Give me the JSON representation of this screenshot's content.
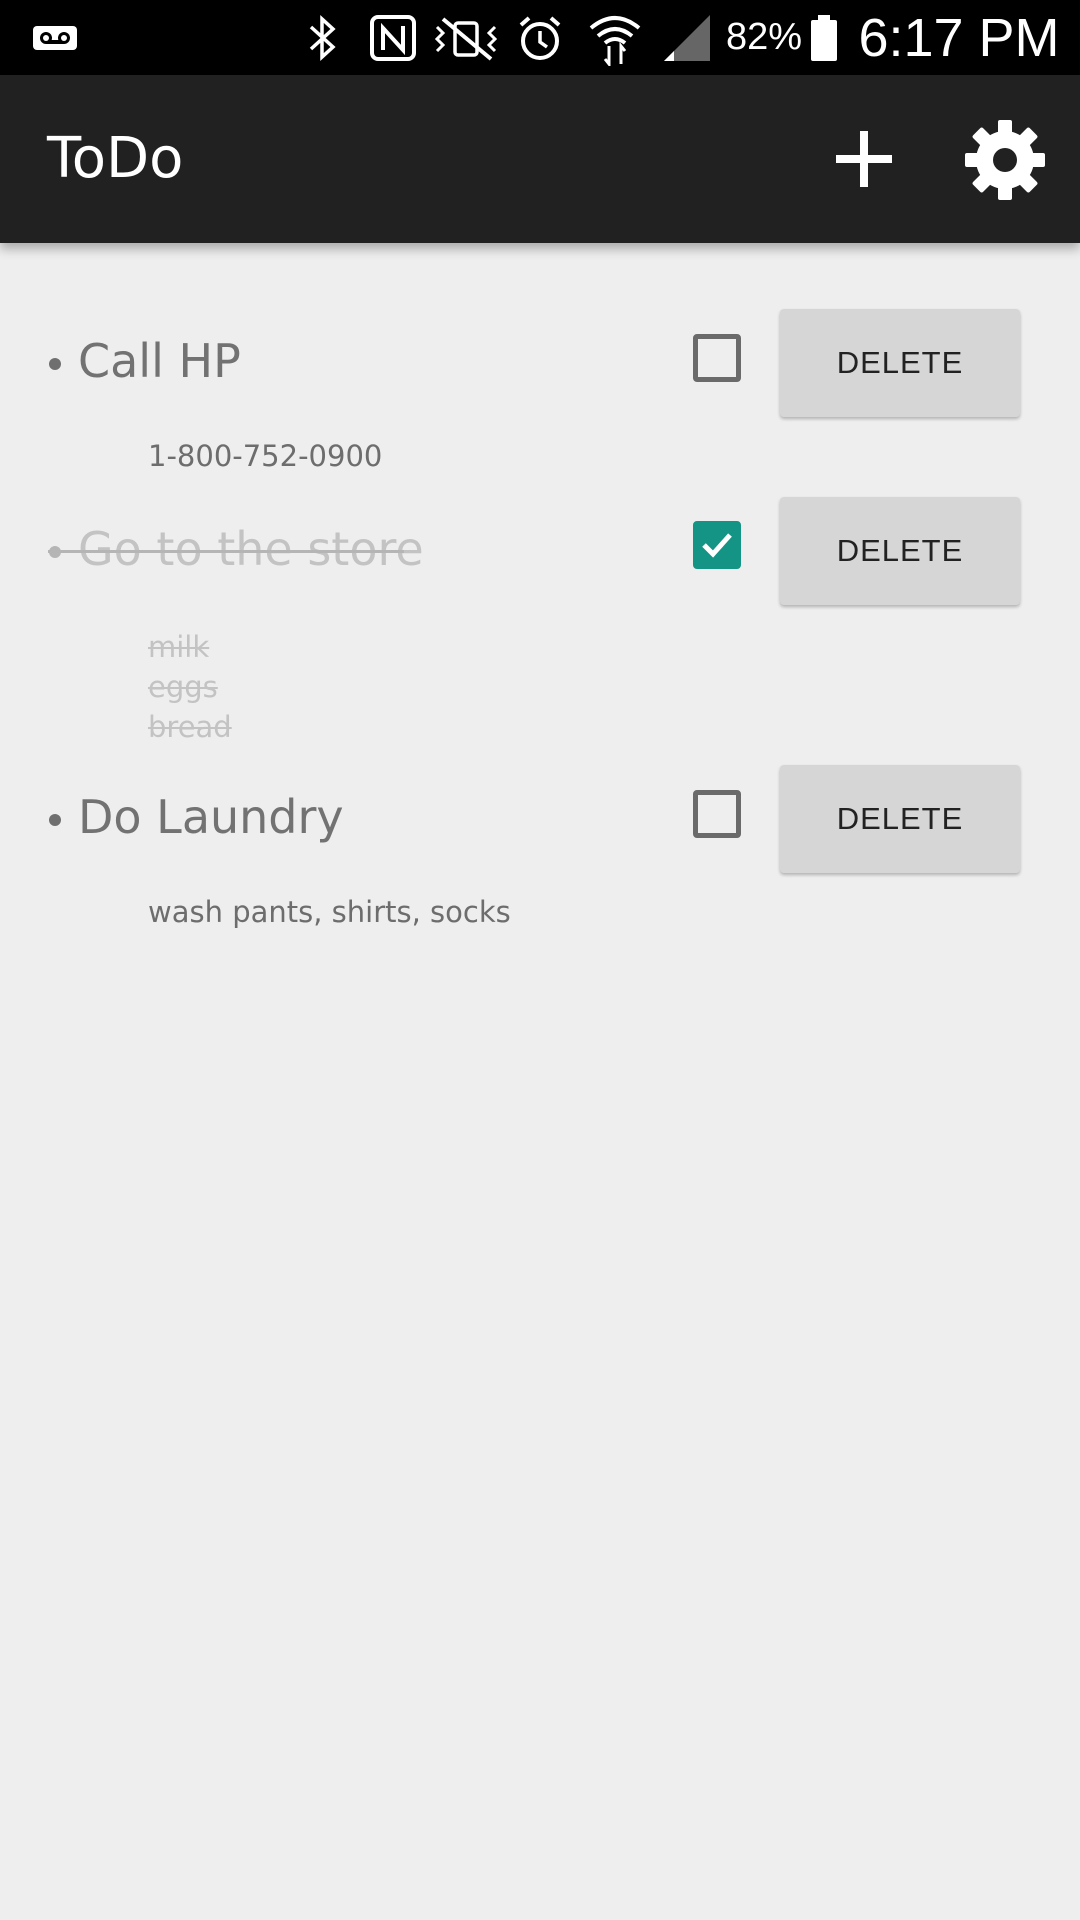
{
  "status_bar": {
    "voicemail_icon": "voicemail-icon",
    "icons": [
      "bluetooth-icon",
      "nfc-icon",
      "vibrate-mute-icon",
      "alarm-icon",
      "wifi-icon",
      "signal-icon",
      "battery-icon"
    ],
    "battery_percent": "82%",
    "time": "6:17 PM"
  },
  "app_bar": {
    "title": "ToDo",
    "add_icon": "plus-icon",
    "settings_icon": "gear-icon"
  },
  "todos": [
    {
      "title": "Call HP",
      "notes": "1-800-752-0900",
      "checked": false,
      "delete_label": "DELETE"
    },
    {
      "title": "Go to the store",
      "notes": "milk\neggs\nbread",
      "checked": true,
      "delete_label": "DELETE"
    },
    {
      "title": "Do Laundry",
      "notes": "wash pants, shirts,  socks",
      "checked": false,
      "delete_label": "DELETE"
    }
  ],
  "colors": {
    "app_bar_bg": "#212121",
    "background": "#eeeeee",
    "accent_checked": "#149484",
    "delete_button_bg": "#d6d6d6"
  }
}
